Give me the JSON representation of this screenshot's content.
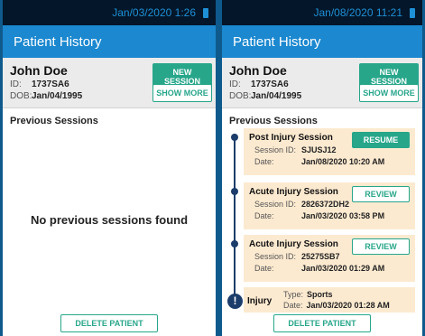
{
  "left_screen": {
    "status_time": "Jan/03/2020 1:26",
    "title": "Patient History",
    "patient": {
      "name": "John Doe",
      "id_label": "ID:",
      "id": "1737SA6",
      "dob_label": "DOB:",
      "dob": "Jan/04/1995"
    },
    "new_session_label": "NEW SESSION",
    "show_more_label": "SHOW MORE",
    "previous_sessions_label": "Previous Sessions",
    "empty_message": "No previous sessions found",
    "delete_label": "DELETE PATIENT"
  },
  "right_screen": {
    "status_time": "Jan/08/2020 11:21",
    "title": "Patient History",
    "patient": {
      "name": "John Doe",
      "id_label": "ID:",
      "id": "1737SA6",
      "dob_label": "DOB:",
      "dob": "Jan/04/1995"
    },
    "new_session_label": "NEW SESSION",
    "show_more_label": "SHOW MORE",
    "previous_sessions_label": "Previous Sessions",
    "sessions": [
      {
        "title": "Post Injury Session",
        "button": "RESUME",
        "id_label": "Session ID:",
        "id": "SJUSJ12",
        "date_label": "Date:",
        "date": "Jan/08/2020 10:20 AM"
      },
      {
        "title": "Acute Injury Session",
        "button": "REVIEW",
        "id_label": "Session ID:",
        "id": "2826372DH2",
        "date_label": "Date:",
        "date": "Jan/03/2020 03:58 PM"
      },
      {
        "title": "Acute Injury Session",
        "button": "REVIEW",
        "id_label": "Session ID:",
        "id": "25275SB7",
        "date_label": "Date:",
        "date": "Jan/03/2020 01:29 AM"
      }
    ],
    "injury": {
      "title": "Injury",
      "type_label": "Type:",
      "type": "Sports",
      "date_label": "Date:",
      "date": "Jan/03/2020 01:28 AM",
      "icon": "!"
    },
    "delete_label": "DELETE PATIENT"
  }
}
